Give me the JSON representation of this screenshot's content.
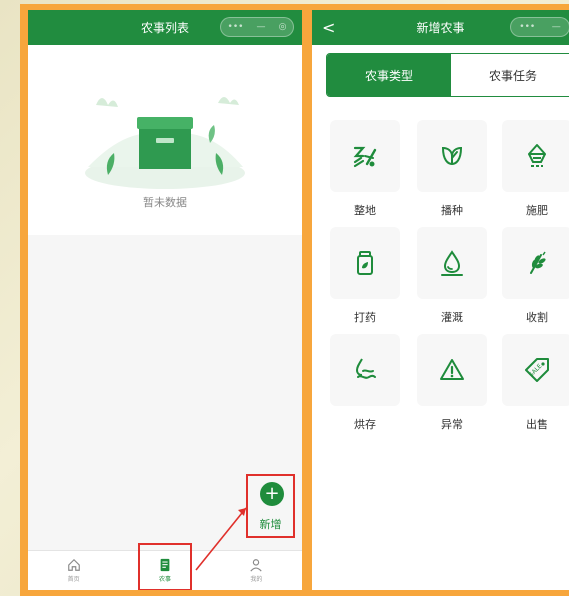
{
  "left_screen": {
    "title": "农事列表",
    "capsule_dots": "•••",
    "capsule_minus": "—",
    "capsule_target": "◎",
    "empty_text": "暂未数据",
    "fab_symbol": "+",
    "fab_label": "新增",
    "tabs": [
      {
        "label": "首页",
        "icon": "home-icon"
      },
      {
        "label": "农事",
        "icon": "note-icon",
        "active": true
      },
      {
        "label": "我的",
        "icon": "user-icon"
      }
    ]
  },
  "right_screen": {
    "back_symbol": "<",
    "title": "新增农事",
    "capsule_dots": "•••",
    "capsule_minus": "—",
    "segments": [
      {
        "label": "农事类型",
        "active": true
      },
      {
        "label": "农事任务",
        "active": false
      }
    ],
    "types": [
      {
        "label": "整地",
        "icon": "tillage-icon"
      },
      {
        "label": "播种",
        "icon": "leaf-icon"
      },
      {
        "label": "施肥",
        "icon": "fertilizer-icon"
      },
      {
        "label": "打药",
        "icon": "pesticide-bottle-icon"
      },
      {
        "label": "灌溉",
        "icon": "water-drop-icon"
      },
      {
        "label": "收割",
        "icon": "wheat-icon"
      },
      {
        "label": "烘存",
        "icon": "drying-icon"
      },
      {
        "label": "异常",
        "icon": "warning-icon"
      },
      {
        "label": "出售",
        "icon": "sale-tag-icon"
      }
    ]
  },
  "colors": {
    "brand_green": "#218c3f",
    "highlight_red": "#e0302b",
    "border_orange": "#f7a63c"
  }
}
